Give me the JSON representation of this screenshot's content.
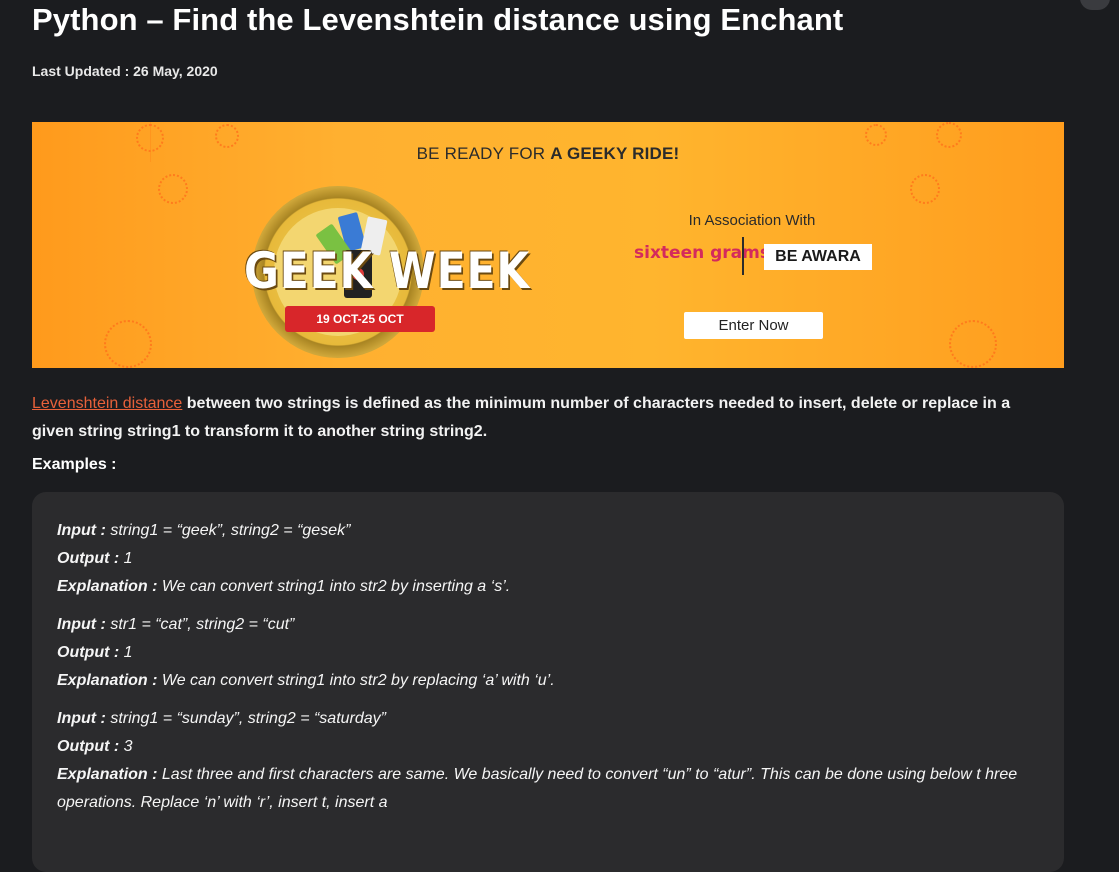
{
  "article": {
    "title": "Python – Find the Levenshtein distance using Enchant",
    "last_updated": "Last Updated : 26 May, 2020"
  },
  "banner": {
    "tagline_pre": "BE READY FOR ",
    "tagline_bold": "A GEEKY RIDE!",
    "brand": "GEEK WEEK",
    "dates": "19 OCT-25 OCT",
    "association": "In Association With",
    "partner1": "sixteen grams",
    "partner2": "BE AWARA",
    "cta": "Enter Now",
    "colors": {
      "background": "#ffa928",
      "ribbon": "#d8262a"
    }
  },
  "intro": {
    "link_text": "Levenshtein distance",
    "text": " between two strings is defined as the minimum number of characters needed to insert, delete or replace in a given string string1 to transform it to another string string2."
  },
  "examples_heading": "Examples :",
  "examples": [
    {
      "input_label": "Input :",
      "input": " string1 = “geek”, string2 = “gesek”",
      "output_label": "Output :",
      "output": " 1",
      "explanation_label": "Explanation :",
      "explanation": " We can convert string1 into str2 by inserting a ‘s’."
    },
    {
      "input_label": "Input :",
      "input": " str1 = “cat”, string2 = “cut”",
      "output_label": "Output :",
      "output": " 1",
      "explanation_label": "Explanation :",
      "explanation": " We can convert string1 into str2 by replacing ‘a’ with ‘u’."
    },
    {
      "input_label": "Input :",
      "input": " string1 = “sunday”, string2 = “saturday”",
      "output_label": "Output :",
      "output": " 3",
      "explanation_label": "Explanation :",
      "explanation": " Last three and first characters are same. We basically need to convert “un” to “atur”. This can be done using below t hree operations. Replace ‘n’ with ‘r’, insert t, insert a"
    }
  ],
  "colors": {
    "page_bg": "#1b1c1f",
    "code_bg": "#2b2b2d",
    "link": "#e8613a"
  }
}
